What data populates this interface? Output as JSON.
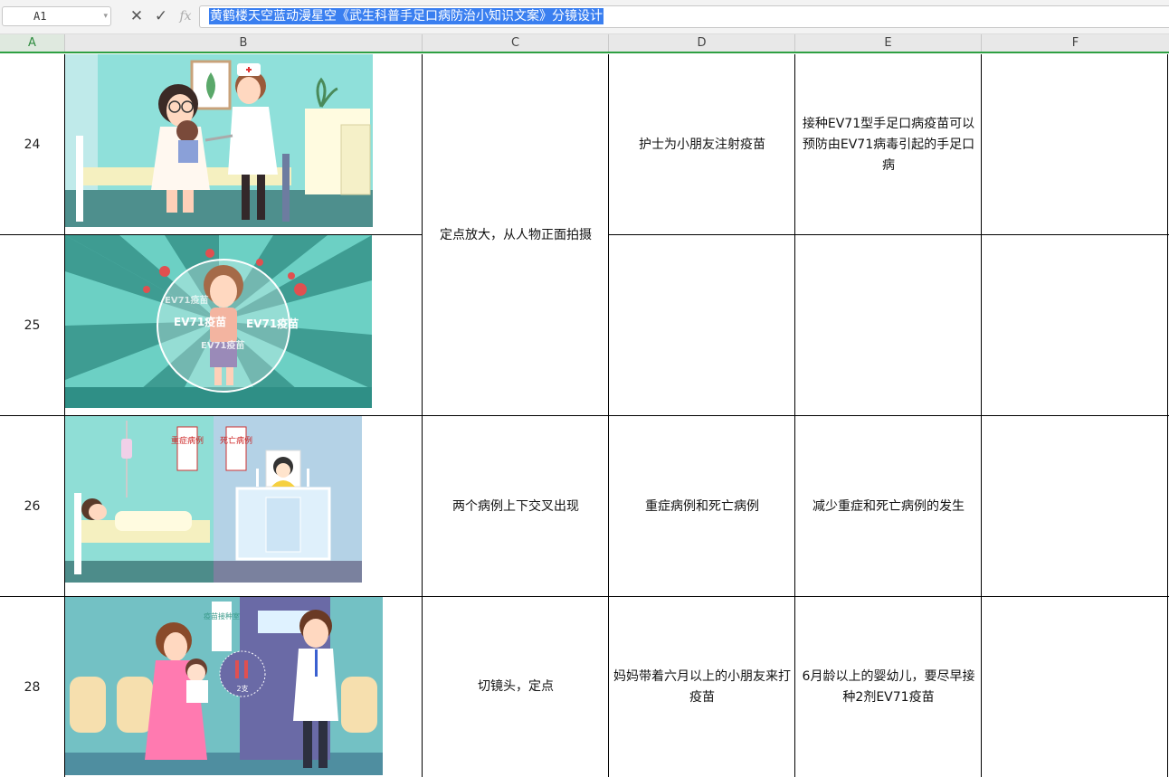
{
  "formula_bar": {
    "name_box": "A1",
    "fx_label": "fx",
    "content": "黄鹤楼天空蓝动漫星空《武生科普手足口病防治小知识文案》分镜设计"
  },
  "columns": [
    "A",
    "B",
    "C",
    "D",
    "E",
    "F"
  ],
  "rows": [
    {
      "num": "24",
      "shot": "",
      "scene": "护士为小朋友注射疫苗",
      "copy": "接种EV71型手足口病疫苗可以预防由EV71病毒引起的手足口病",
      "note": ""
    },
    {
      "num": "25",
      "shot": "",
      "scene": "",
      "copy": "",
      "note": ""
    },
    {
      "num": "26",
      "shot": "两个病例上下交叉出现",
      "scene": "重症病例和死亡病例",
      "copy": "减少重症和死亡病例的发生",
      "note": ""
    },
    {
      "num": "28",
      "shot": "切镜头，定点",
      "scene": "妈妈带着六月以上的小朋友来打疫苗",
      "copy": "6月龄以上的婴幼儿，要尽早接种2剂EV71疫苗",
      "note": ""
    }
  ],
  "merged_shot_24_25": "定点放大，从人物正面拍摄",
  "image_texts": {
    "vaccine_label": "EV71疫苗",
    "severe_sign": "重症病例",
    "death_sign": "死亡病例",
    "room_sign": "疫苗接种室",
    "dose_label": "2支"
  },
  "colors": {
    "accent": "#2ea043",
    "selection": "#3a7ff0",
    "teal": "#5fc9c0",
    "teal_dark": "#2f8f86"
  }
}
